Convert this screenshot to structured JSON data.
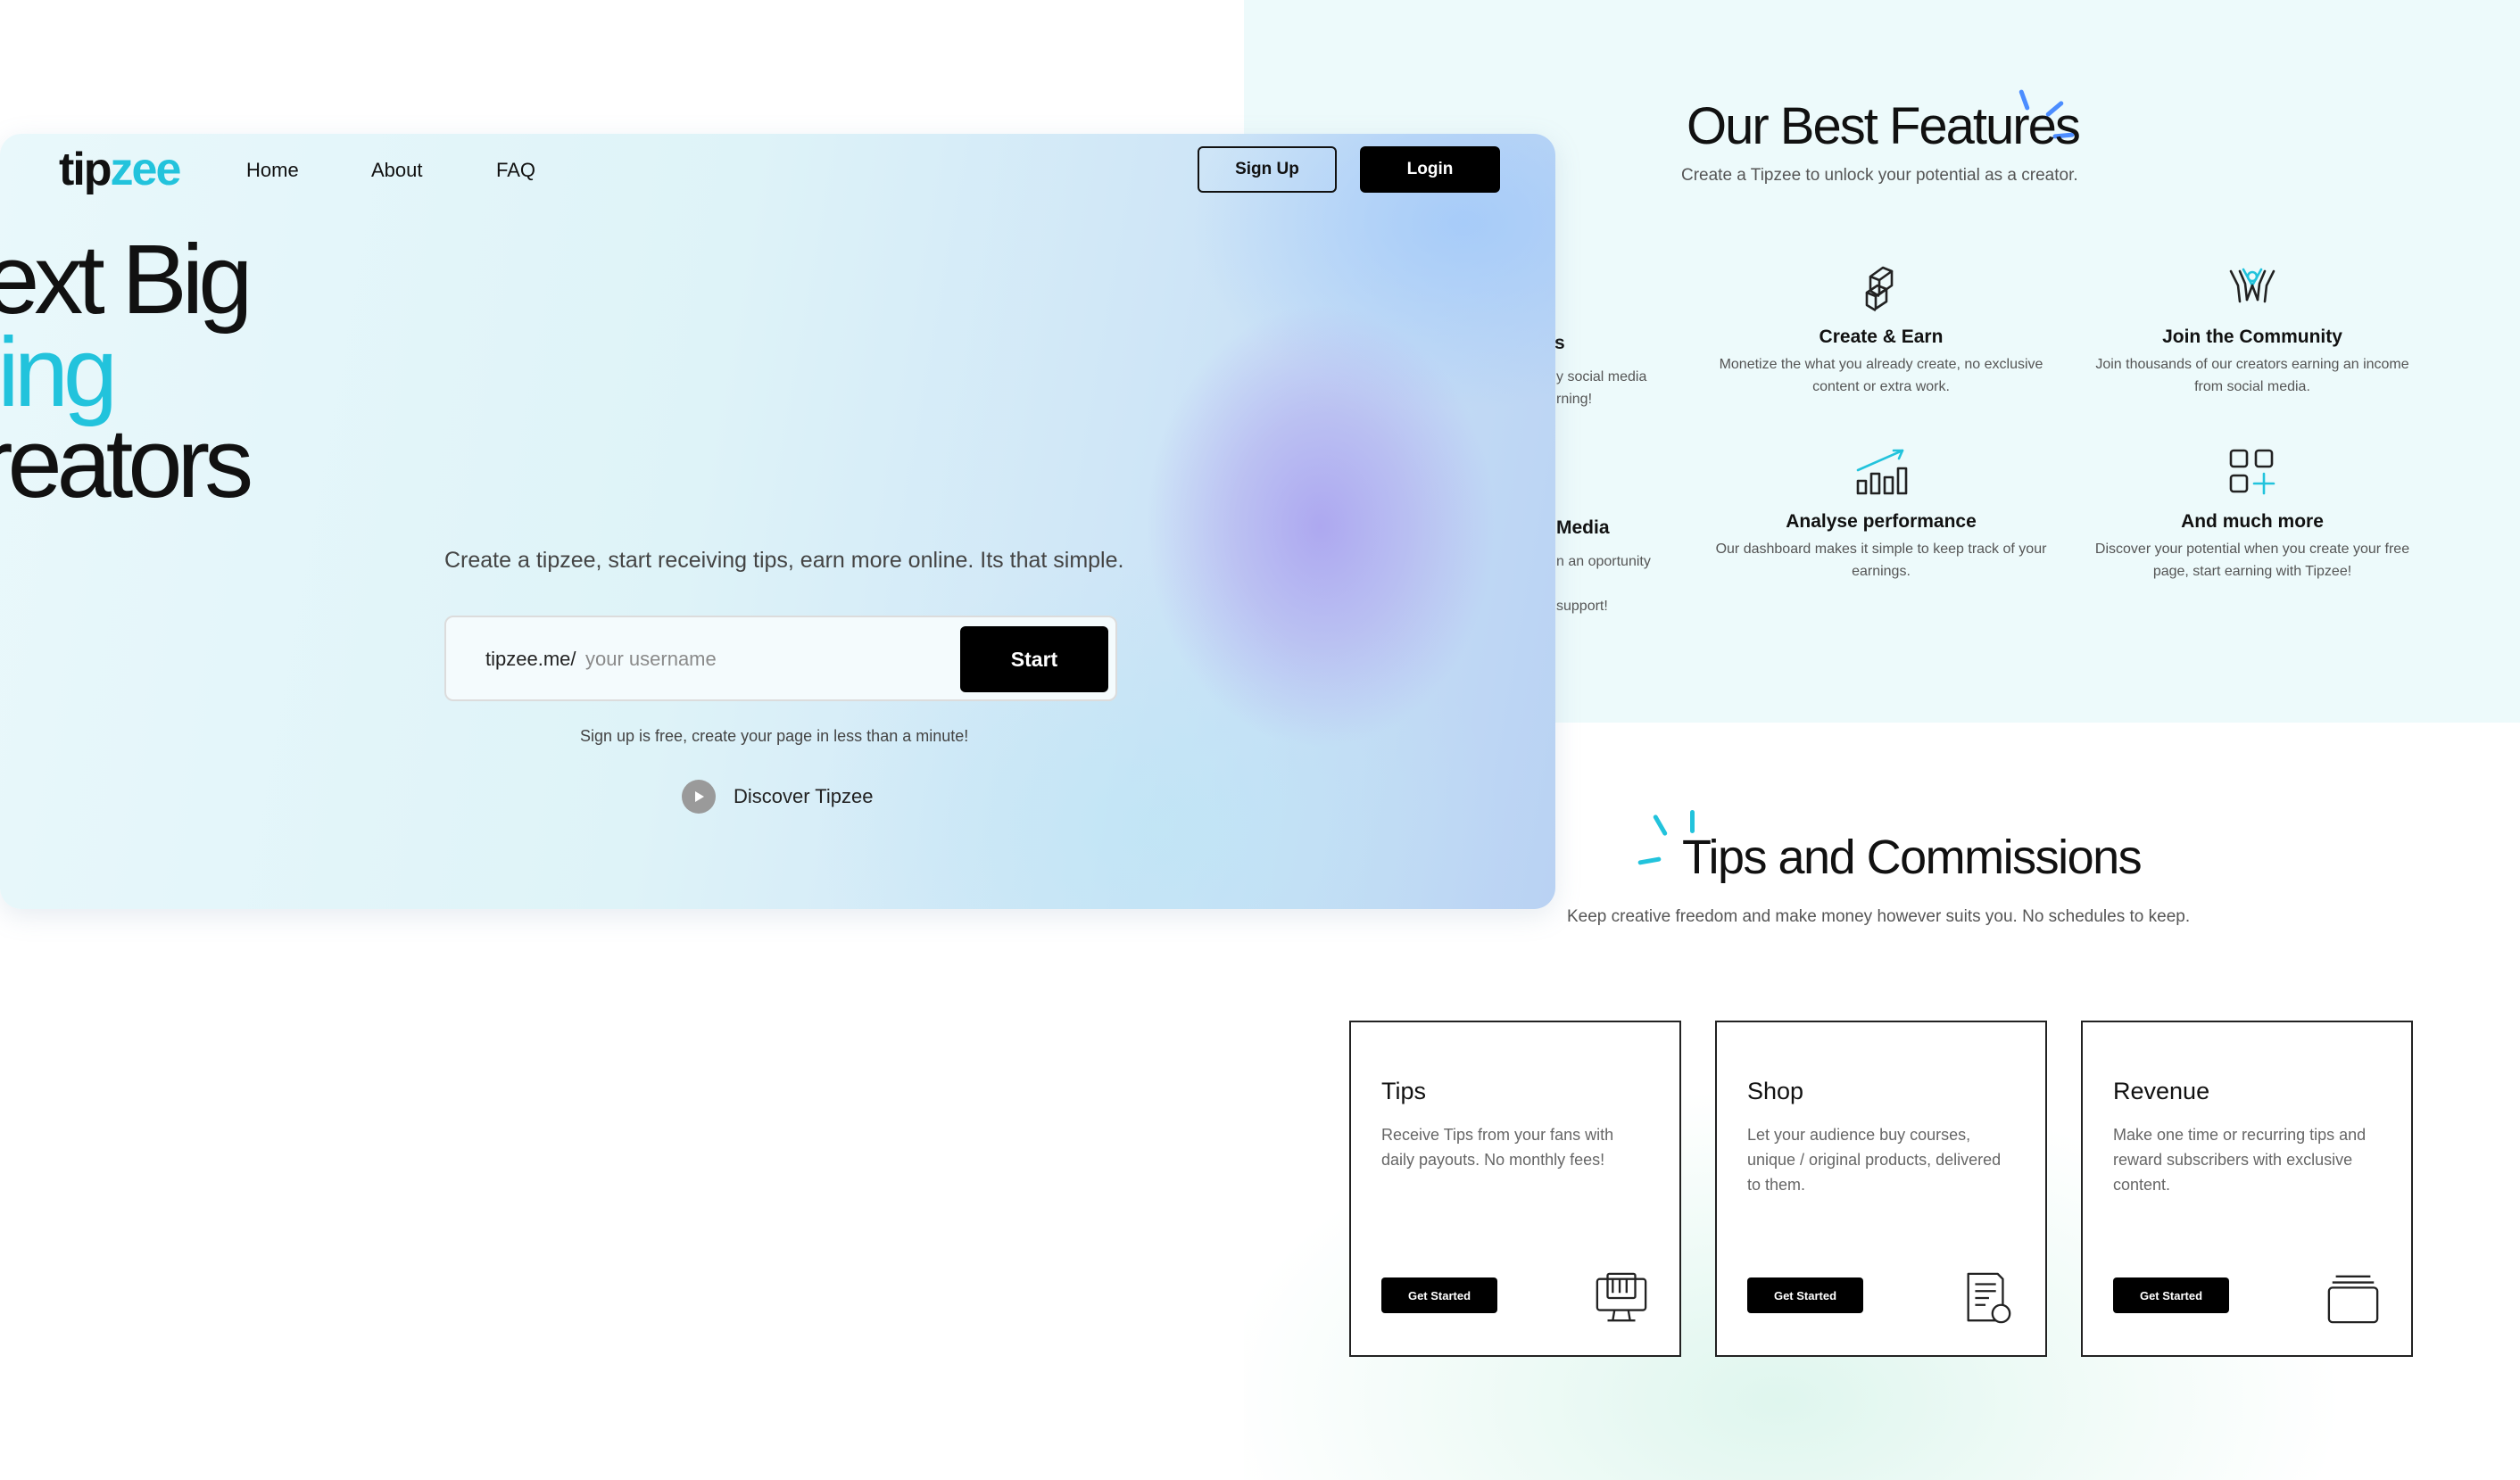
{
  "hero": {
    "logo_part1": "tip",
    "logo_part2": "zee",
    "nav": [
      "Home",
      "About",
      "FAQ"
    ],
    "signup_label": "Sign Up",
    "login_label": "Login",
    "headline_line1": "The Next Big",
    "headline_line2": "Thing",
    "headline_line3": "For Creators",
    "subtitle": "Create a tipzee, start receiving tips, earn more online. Its that simple.",
    "input_prefix": "tipzee.me/",
    "input_placeholder": "your username",
    "start_label": "Start",
    "note": "Sign up is free, create your page in less than a minute!",
    "discover_label": "Discover Tipzee"
  },
  "features": {
    "title": "Our Best Features",
    "subtitle": "Create a Tipzee to unlock your potential as a creator.",
    "partial_left": {
      "row1_title_fragment": "s",
      "row1_desc_fragments": [
        "y social media",
        "rning!"
      ],
      "row2_title_fragment": "Media",
      "row2_desc_fragments": [
        "n an oportunity",
        "support!"
      ]
    },
    "items": [
      {
        "icon": "box-stack-icon",
        "title": "Create & Earn",
        "desc": "Monetize the what you already create, no exclusive content or extra work."
      },
      {
        "icon": "community-icon",
        "title": "Join the Community",
        "desc": "Join thousands of our creators earning an income from social media."
      },
      {
        "icon": "chart-growth-icon",
        "title": "Analyse performance",
        "desc": "Our dashboard makes it simple to keep track of your earnings."
      },
      {
        "icon": "grid-plus-icon",
        "title": "And much more",
        "desc": "Discover your potential when you create your free page, start earning with Tipzee!"
      }
    ]
  },
  "tips": {
    "title": "Tips and Commissions",
    "subtitle": "Keep creative freedom and make money however suits you. No schedules to keep.",
    "cards": [
      {
        "title": "Tips",
        "desc": "Receive Tips from your fans with daily payouts. No monthly fees!",
        "button": "Get Started",
        "icon": "monitor-icon"
      },
      {
        "title": "Shop",
        "desc": "Let your audience buy courses, unique / original products, delivered to them.",
        "button": "Get Started",
        "icon": "document-icon"
      },
      {
        "title": "Revenue",
        "desc": "Make one time or recurring tips and reward subscribers with exclusive content.",
        "button": "Get Started",
        "icon": "stack-icon"
      }
    ]
  },
  "colors": {
    "accent": "#22c3dc",
    "spark_blue": "#4c8dff",
    "button": "#000000"
  }
}
